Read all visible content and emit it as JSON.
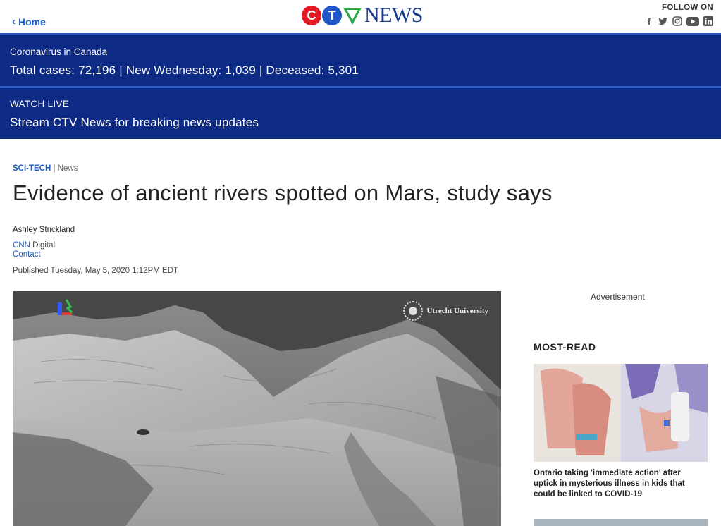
{
  "header": {
    "home_label": "Home",
    "logo_letters": [
      "C",
      "T",
      "V"
    ],
    "logo_word": "NEWS",
    "follow_label": "FOLLOW ON",
    "social_icons": [
      "facebook-icon",
      "twitter-icon",
      "instagram-icon",
      "youtube-icon",
      "linkedin-icon"
    ],
    "accent": "#2c57c5"
  },
  "banners": {
    "covid": {
      "title": "Coronavirus in Canada",
      "text": "Total cases: 72,196 | New Wednesday: 1,039 | Deceased: 5,301"
    },
    "live": {
      "title": "WATCH LIVE",
      "text": "Stream CTV News for breaking news updates"
    },
    "background": "#0d2a84"
  },
  "article": {
    "section": "SCI-TECH",
    "separator": "|",
    "subsection": "News",
    "headline": "Evidence of ancient rivers spotted on Mars, study says",
    "author": "Ashley Strickland",
    "org_name": "CNN",
    "org_suffix": "Digital",
    "contact": "Contact",
    "published": "Published Tuesday, May 5, 2020 1:12PM EDT",
    "image_credit": "Utrecht University"
  },
  "sidebar": {
    "ad_label": "Advertisement",
    "most_read_title": "MOST-READ",
    "most_read_items": [
      {
        "caption": "Ontario taking 'immediate action' after uptick in mysterious illness in kids that could be linked to COVID-19"
      }
    ]
  }
}
